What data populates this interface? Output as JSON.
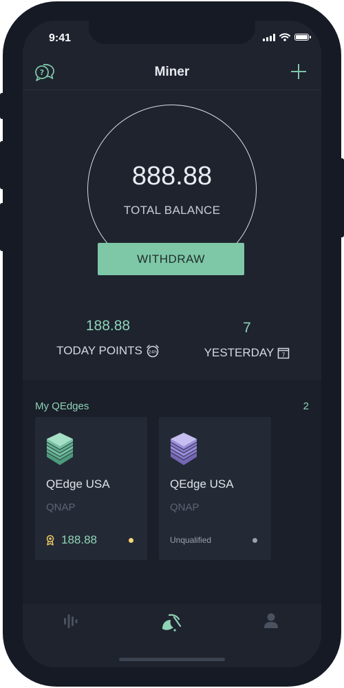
{
  "status_bar": {
    "time": "9:41"
  },
  "header": {
    "title": "Miner",
    "help_icon": "chat-question-icon",
    "add_icon": "plus-icon"
  },
  "balance": {
    "value": "888.88",
    "label": "TOTAL BALANCE",
    "withdraw_label": "WITHDRAW"
  },
  "stats": {
    "today": {
      "value": "188.88",
      "label": "TODAY POINTS",
      "icon": "alarm-24h-icon"
    },
    "yesterday": {
      "value": "7",
      "label": "YESTERDAY",
      "icon": "calendar-7-icon"
    }
  },
  "qedges": {
    "title": "My QEdges",
    "count": "2",
    "cards": [
      {
        "name": "QEdge USA",
        "brand": "QNAP",
        "points": "188.88",
        "status_color": "#f6d67a",
        "icon_color": "#7ec7a7",
        "badge_icon": "award-icon"
      },
      {
        "name": "QEdge USA",
        "brand": "QNAP",
        "status": "Unqualified",
        "status_color": "#9aa1ad",
        "icon_color": "#a89ae0"
      }
    ]
  },
  "tabbar": {
    "items": [
      {
        "name": "stats",
        "icon": "waveform-icon"
      },
      {
        "name": "miner",
        "icon": "mining-icon",
        "active": true
      },
      {
        "name": "profile",
        "icon": "user-icon"
      }
    ]
  },
  "colors": {
    "accent": "#8fd3b7",
    "button": "#7ec7a7",
    "background": "#1e232e"
  }
}
